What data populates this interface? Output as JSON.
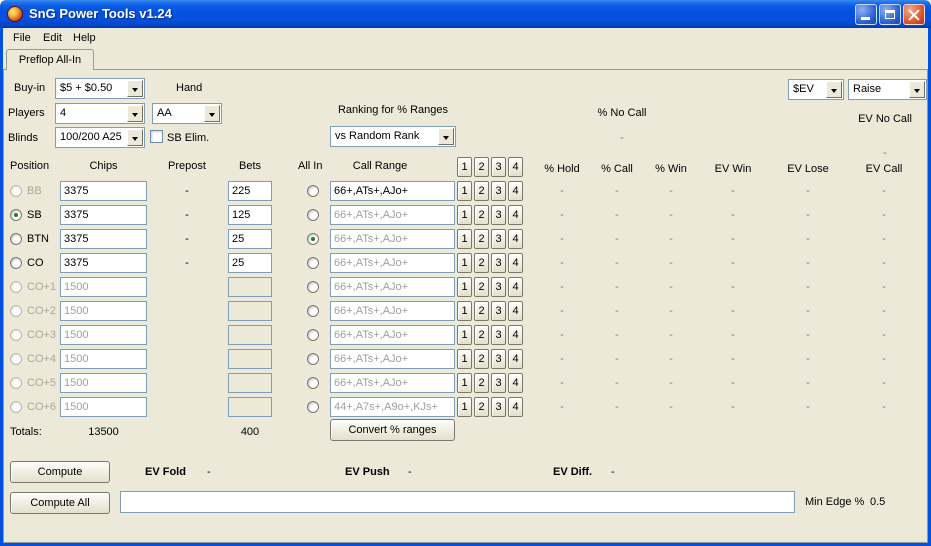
{
  "window": {
    "title": "SnG Power Tools v1.24"
  },
  "menu": {
    "items": [
      "File",
      "Edit",
      "Help"
    ]
  },
  "tabs": {
    "preflop": "Preflop All-In"
  },
  "top": {
    "buyin_label": "Buy-in",
    "buyin_value": "$5 + $0.50",
    "players_label": "Players",
    "players_value": "4",
    "hand_label": "Hand",
    "hand_value": "AA",
    "blinds_label": "Blinds",
    "blinds_value": "100/200 A25",
    "sb_elim_label": "SB Elim.",
    "ranking_label": "Ranking for % Ranges",
    "ranking_value": "vs Random Rank",
    "ev_mode_value": "$EV",
    "action_value": "Raise",
    "no_call_label": "% No Call",
    "no_call_value": "-",
    "ev_no_call_label": "EV No Call",
    "ev_no_call_value": "-"
  },
  "table": {
    "headers": {
      "position": "Position",
      "chips": "Chips",
      "prepost": "Prepost",
      "bets": "Bets",
      "allin": "All In",
      "call_range": "Call Range"
    },
    "stat_headers": [
      "% Hold",
      "% Call",
      "% Win",
      "EV Win",
      "EV Lose",
      "EV Call"
    ],
    "range_buttons": [
      "1",
      "2",
      "3",
      "4"
    ],
    "rows": [
      {
        "position": "BB",
        "enabled": false,
        "selected": false,
        "chips": "3375",
        "chips_enabled": true,
        "prepost": "-",
        "bets": "225",
        "bets_enabled": true,
        "allin_selected": false,
        "call_range": "66+,ATs+,AJo+",
        "range_enabled": true,
        "stats": [
          "-",
          "-",
          "-",
          "-",
          "-",
          "-"
        ]
      },
      {
        "position": "SB",
        "enabled": true,
        "selected": true,
        "chips": "3375",
        "chips_enabled": true,
        "prepost": "-",
        "bets": "125",
        "bets_enabled": true,
        "allin_selected": false,
        "call_range": "66+,ATs+,AJo+",
        "range_enabled": false,
        "stats": [
          "-",
          "-",
          "-",
          "-",
          "-",
          "-"
        ]
      },
      {
        "position": "BTN",
        "enabled": true,
        "selected": false,
        "chips": "3375",
        "chips_enabled": true,
        "prepost": "-",
        "bets": "25",
        "bets_enabled": true,
        "allin_selected": true,
        "call_range": "66+,ATs+,AJo+",
        "range_enabled": false,
        "stats": [
          "-",
          "-",
          "-",
          "-",
          "-",
          "-"
        ]
      },
      {
        "position": "CO",
        "enabled": true,
        "selected": false,
        "chips": "3375",
        "chips_enabled": true,
        "prepost": "-",
        "bets": "25",
        "bets_enabled": true,
        "allin_selected": false,
        "call_range": "66+,ATs+,AJo+",
        "range_enabled": false,
        "stats": [
          "-",
          "-",
          "-",
          "-",
          "-",
          "-"
        ]
      },
      {
        "position": "CO+1",
        "enabled": false,
        "selected": false,
        "chips": "1500",
        "chips_enabled": false,
        "prepost": "",
        "bets": "",
        "bets_enabled": false,
        "allin_selected": false,
        "call_range": "66+,ATs+,AJo+",
        "range_enabled": false,
        "stats": [
          "-",
          "-",
          "-",
          "-",
          "-",
          "-"
        ]
      },
      {
        "position": "CO+2",
        "enabled": false,
        "selected": false,
        "chips": "1500",
        "chips_enabled": false,
        "prepost": "",
        "bets": "",
        "bets_enabled": false,
        "allin_selected": false,
        "call_range": "66+,ATs+,AJo+",
        "range_enabled": false,
        "stats": [
          "-",
          "-",
          "-",
          "-",
          "-",
          "-"
        ]
      },
      {
        "position": "CO+3",
        "enabled": false,
        "selected": false,
        "chips": "1500",
        "chips_enabled": false,
        "prepost": "",
        "bets": "",
        "bets_enabled": false,
        "allin_selected": false,
        "call_range": "66+,ATs+,AJo+",
        "range_enabled": false,
        "stats": [
          "-",
          "-",
          "-",
          "-",
          "-",
          "-"
        ]
      },
      {
        "position": "CO+4",
        "enabled": false,
        "selected": false,
        "chips": "1500",
        "chips_enabled": false,
        "prepost": "",
        "bets": "",
        "bets_enabled": false,
        "allin_selected": false,
        "call_range": "66+,ATs+,AJo+",
        "range_enabled": false,
        "stats": [
          "-",
          "-",
          "-",
          "-",
          "-",
          "-"
        ]
      },
      {
        "position": "CO+5",
        "enabled": false,
        "selected": false,
        "chips": "1500",
        "chips_enabled": false,
        "prepost": "",
        "bets": "",
        "bets_enabled": false,
        "allin_selected": false,
        "call_range": "66+,ATs+,AJo+",
        "range_enabled": false,
        "stats": [
          "-",
          "-",
          "-",
          "-",
          "-",
          "-"
        ]
      },
      {
        "position": "CO+6",
        "enabled": false,
        "selected": false,
        "chips": "1500",
        "chips_enabled": false,
        "prepost": "",
        "bets": "",
        "bets_enabled": false,
        "allin_selected": false,
        "call_range": "44+,A7s+,A9o+,KJs+",
        "range_enabled": false,
        "stats": [
          "-",
          "-",
          "-",
          "-",
          "-",
          "-"
        ]
      }
    ],
    "totals_label": "Totals:",
    "totals_chips": "13500",
    "totals_bets": "400",
    "convert_button": "Convert % ranges"
  },
  "bottom": {
    "compute_button": "Compute",
    "compute_all_button": "Compute All",
    "ev_fold_label": "EV Fold",
    "ev_fold_value": "-",
    "ev_push_label": "EV Push",
    "ev_push_value": "-",
    "ev_diff_label": "EV Diff.",
    "ev_diff_value": "-",
    "status_value": "",
    "min_edge_label": "Min Edge %",
    "min_edge_value": "0.5"
  }
}
